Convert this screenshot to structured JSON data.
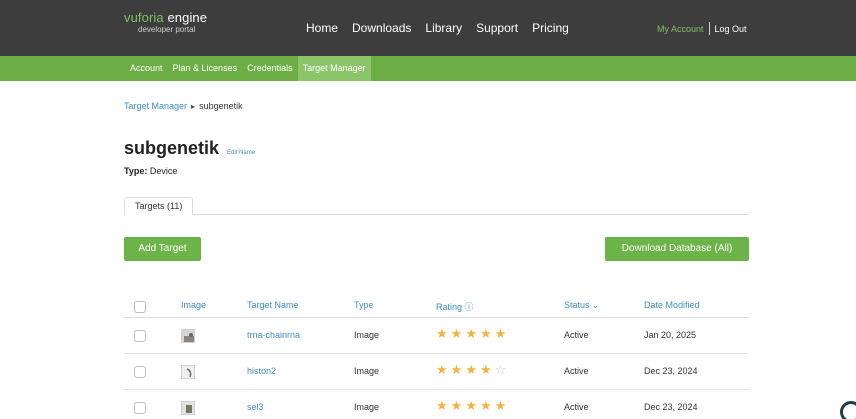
{
  "header": {
    "logo_vuforia": "vuforia",
    "logo_engine": "engine",
    "logo_sub": "developer portal",
    "nav": [
      "Home",
      "Downloads",
      "Library",
      "Support",
      "Pricing"
    ],
    "my_account": "My Account",
    "log_out": "Log Out"
  },
  "subnav": {
    "items": [
      "Account",
      "Plan & Licenses",
      "Credentials",
      "Target Manager"
    ],
    "active": "Target Manager"
  },
  "breadcrumb": {
    "parent": "Target Manager",
    "current": "subgenetik"
  },
  "database": {
    "name": "subgenetik",
    "edit_label": "Edit Name",
    "type_label": "Type:",
    "type_value": "Device"
  },
  "tabs": [
    "Targets (11)"
  ],
  "buttons": {
    "add": "Add Target",
    "download": "Download Database (All)"
  },
  "table": {
    "headers": {
      "image": "Image",
      "name": "Target Name",
      "type": "Type",
      "rating": "Rating",
      "status": "Status",
      "date": "Date Modified"
    },
    "rows": [
      {
        "name": "trna-chainrna",
        "type": "Image",
        "rating": 5,
        "status": "Active",
        "date": "Jan 20, 2025"
      },
      {
        "name": "histon2",
        "type": "Image",
        "rating": 4,
        "status": "Active",
        "date": "Dec 23, 2024"
      },
      {
        "name": "sel3",
        "type": "Image",
        "rating": 5,
        "status": "Active",
        "date": "Dec 23, 2024"
      }
    ]
  },
  "colors": {
    "topbar": "#3d3d3d",
    "subnav": "#6cae45",
    "accent": "#6cb34a",
    "link": "#3c8fc4",
    "star": "#f2b43a"
  }
}
